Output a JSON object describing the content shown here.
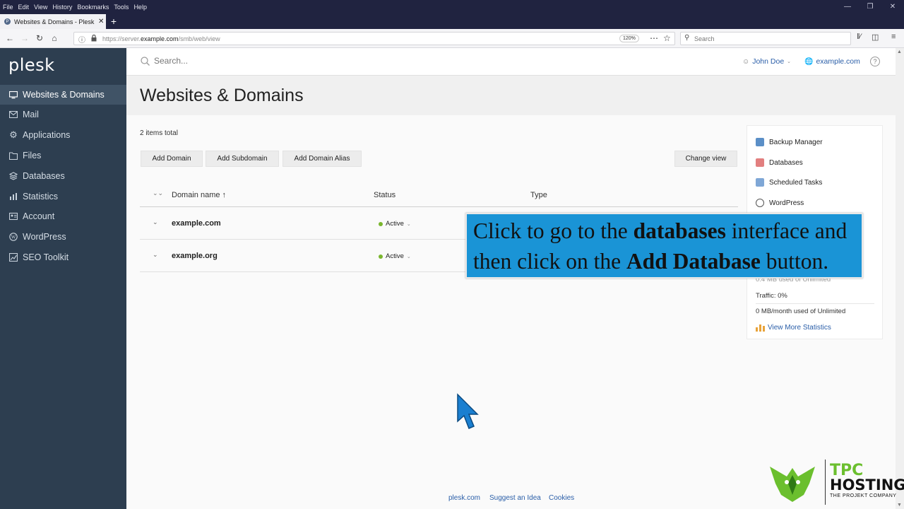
{
  "browser": {
    "menu": [
      "File",
      "Edit",
      "View",
      "History",
      "Bookmarks",
      "Tools",
      "Help"
    ],
    "tab_title": "Websites & Domains - Plesk O",
    "url_prefix": "https://server.",
    "url_host": "example.com",
    "url_path": "/smb/web/view",
    "zoom": "120%",
    "search_placeholder": "Search"
  },
  "app": {
    "logo": "plesk",
    "search_placeholder": "Search...",
    "user": "John Doe",
    "subscription": "example.com"
  },
  "sidebar": {
    "items": [
      {
        "label": "Websites & Domains",
        "icon": "monitor-icon",
        "active": true
      },
      {
        "label": "Mail",
        "icon": "mail-icon"
      },
      {
        "label": "Applications",
        "icon": "gear-icon"
      },
      {
        "label": "Files",
        "icon": "folder-icon"
      },
      {
        "label": "Databases",
        "icon": "database-icon"
      },
      {
        "label": "Statistics",
        "icon": "bar-chart-icon"
      },
      {
        "label": "Account",
        "icon": "account-icon"
      },
      {
        "label": "WordPress",
        "icon": "wordpress-icon"
      },
      {
        "label": "SEO Toolkit",
        "icon": "seo-icon"
      }
    ]
  },
  "page": {
    "title": "Websites & Domains",
    "items_total": "2 items total",
    "buttons": {
      "add_domain": "Add Domain",
      "add_subdomain": "Add Subdomain",
      "add_alias": "Add Domain Alias",
      "change_view": "Change view"
    },
    "table": {
      "headers": {
        "domain": "Domain name ↑",
        "status": "Status",
        "type": "Type"
      },
      "rows": [
        {
          "domain": "example.com",
          "status": "Active"
        },
        {
          "domain": "example.org",
          "status": "Active"
        }
      ]
    }
  },
  "panel": {
    "links": [
      {
        "label": "Backup Manager",
        "icon": "backup-icon"
      },
      {
        "label": "Databases",
        "icon": "database-icon"
      },
      {
        "label": "Scheduled Tasks",
        "icon": "calendar-icon"
      },
      {
        "label": "WordPress",
        "icon": "wordpress-icon"
      }
    ],
    "disk_used": "0.4 MB used of Unlimited",
    "traffic_label": "Traffic: 0%",
    "traffic_used": "0 MB/month used of Unlimited",
    "more_stats": "View More Statistics"
  },
  "overlay": {
    "line1_a": "Click to go to the ",
    "line1_b": "databases",
    "line1_c": " interface and",
    "line2_a": "then click on the ",
    "line2_b": "Add Database",
    "line2_c": " button."
  },
  "footer": {
    "links": [
      "plesk.com",
      "Suggest an Idea",
      "Cookies"
    ]
  },
  "watermark": {
    "line1": "TPC",
    "line2": "HOSTING",
    "line3": "THE PROJEKT COMPANY"
  },
  "colors": {
    "sidebar_bg": "#2d3e50",
    "link": "#2a5ea8",
    "banner": "#1a94d6",
    "status_active": "#7ab62e"
  }
}
